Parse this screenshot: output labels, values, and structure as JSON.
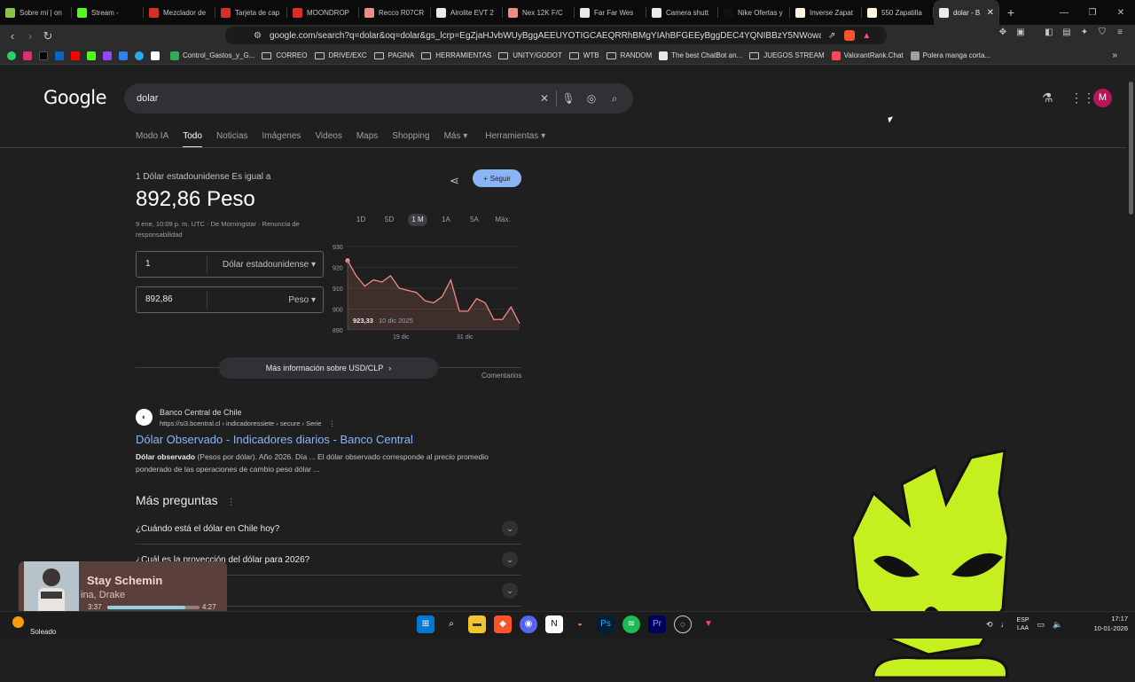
{
  "tabs": [
    {
      "title": "Sobre mí | on",
      "color": "#8bc34a",
      "icon": "leaf-favicon"
    },
    {
      "title": "Stream - ",
      "color": "#53fc18",
      "icon": "kick-favicon"
    },
    {
      "title": "Mezclador de",
      "color": "#d93025",
      "icon": "gmail-favicon"
    },
    {
      "title": "Tarjeta de cap",
      "color": "#d93025",
      "icon": "gmail-favicon"
    },
    {
      "title": "MOONDROP",
      "color": "#d93025",
      "icon": "gmail-favicon"
    },
    {
      "title": "Recco R07CR",
      "color": "#f28b82",
      "icon": "shoe-favicon"
    },
    {
      "title": "Airolite EVT 2",
      "color": "#e8eaed",
      "icon": "google-favicon"
    },
    {
      "title": "Nex 12K F/C",
      "color": "#f28b82",
      "icon": "shoe-favicon"
    },
    {
      "title": "Far Far Wes",
      "color": "#e8eaed",
      "icon": "google-favicon"
    },
    {
      "title": "Camera shutt",
      "color": "#e8eaed",
      "icon": "google-favicon"
    },
    {
      "title": "Nike Ofertas y",
      "color": "#111111",
      "icon": "nike-favicon"
    },
    {
      "title": "Inverse Zapat",
      "color": "#fff8e1",
      "icon": "store-favicon"
    },
    {
      "title": "550 Zapatilla",
      "color": "#fff8e1",
      "icon": "store-favicon"
    },
    {
      "title": "dolar - B",
      "color": "#e8eaed",
      "icon": "google-favicon"
    }
  ],
  "url": "google.com/search?q=dolar&oq=dolar&gs_lcrp=EgZjaHJvbWUyBggAEEUYOTIGCAEQRRhBMgYIAhBFGEEyBggDEC4YQNIBBzY5NWowajGoAgCwAgA...",
  "bookmarks": [
    {
      "label": "Control_Gastos_y_G...",
      "type": "site",
      "color": "#34a853"
    },
    {
      "label": "CORREO",
      "type": "folder"
    },
    {
      "label": "DRIVE/EXC",
      "type": "folder"
    },
    {
      "label": "PAGINA",
      "type": "folder"
    },
    {
      "label": "HERRAMIENTAS",
      "type": "folder"
    },
    {
      "label": "UNITY/GODOT",
      "type": "folder"
    },
    {
      "label": "WTB",
      "type": "folder"
    },
    {
      "label": "RANDOM",
      "type": "folder"
    },
    {
      "label": "The best ChatBot an...",
      "type": "site",
      "color": "#e8eaed"
    },
    {
      "label": "JUEGOS STREAM",
      "type": "folder"
    },
    {
      "label": "ValorantRank.Chat",
      "type": "site",
      "color": "#ff4655"
    },
    {
      "label": "Polera manga corta...",
      "type": "site",
      "color": "#9aa0a6"
    }
  ],
  "google": {
    "logo": "Google",
    "query": "dolar",
    "navtabs": [
      "Modo IA",
      "Todo",
      "Noticias",
      "Imágenes",
      "Videos",
      "Maps",
      "Shopping",
      "Más ▾",
      "Herramientas ▾"
    ],
    "avatar": "M"
  },
  "currency": {
    "label": "1 Dólar estadounidense Es igual a",
    "value": "892,86 Peso",
    "meta": "9 ene, 10:09 p. m. UTC · De Morningstar · Renuncia de responsabilidad",
    "follow": "Seguir",
    "ranges": [
      "1D",
      "5D",
      "1 M",
      "1A",
      "5A",
      "Máx."
    ],
    "from_amount": "1",
    "from_unit": "Dólar estadounidense",
    "to_amount": "892,86",
    "to_unit": "Peso",
    "more_info": "Más información sobre USD/CLP",
    "comments": "Comentarios"
  },
  "chart_data": {
    "type": "line",
    "yticks": [
      930,
      920,
      910,
      900,
      890
    ],
    "ylim": [
      890,
      930
    ],
    "xticks": [
      "19 dic",
      "31 dic"
    ],
    "tooltip_value": "923,33",
    "tooltip_date": "10 dic 2025",
    "values": [
      923.3,
      916,
      911,
      914,
      913,
      916,
      910,
      909,
      908,
      904,
      903,
      906,
      914,
      899,
      899,
      905,
      903,
      895,
      895,
      901,
      893
    ],
    "color": "#f28b82"
  },
  "result": {
    "site": "Banco Central de Chile",
    "url": "https://si3.bcentral.cl › indicadoressiete › secure › Serie",
    "title": "Dólar Observado - Indicadores diarios - Banco Central",
    "snippet_bold": "Dólar observado",
    "snippet": " (Pesos por dólar). Año 2026. Día ... El dólar observado corresponde al precio promedio ponderado de las operaciones de cambio peso dólar ..."
  },
  "paa": {
    "title": "Más preguntas",
    "questions": [
      "¿Cuándo está el dólar en Chile hoy?",
      "¿Cuál es la proyección del dólar para 2026?",
      "hoy?"
    ]
  },
  "music": {
    "song": "Stay Schemin",
    "artist": "ina, Drake",
    "elapsed": "3:37",
    "total": "4:27",
    "progress": 0.85
  },
  "taskbar": {
    "weather": "Soleado",
    "lang": "ESP",
    "lang2": "LAA",
    "time": "17:17",
    "date": "10-01-2026"
  }
}
